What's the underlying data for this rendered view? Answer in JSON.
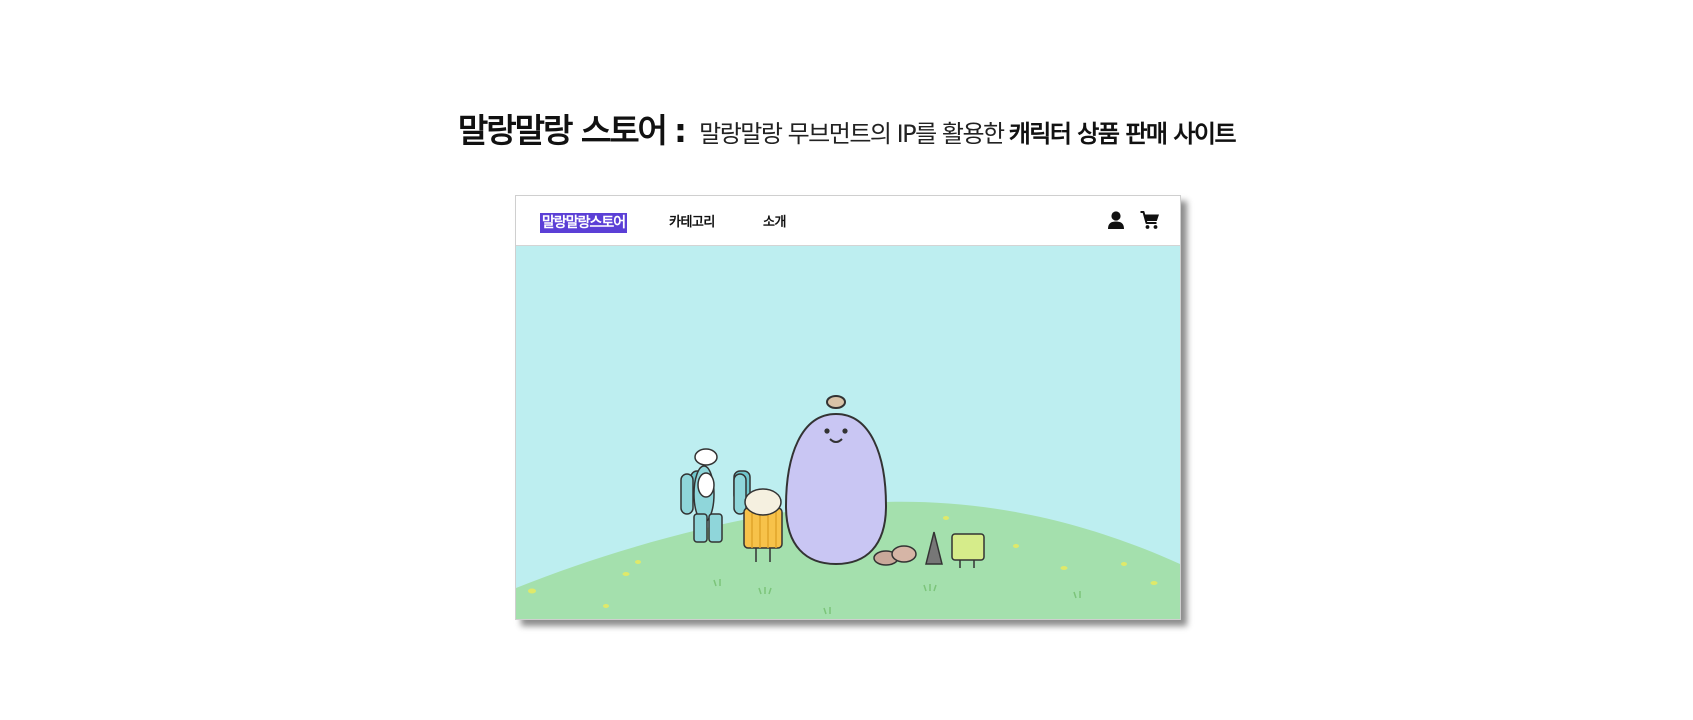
{
  "headline": {
    "brand": "말랑말랑 스토어",
    "colon": ":",
    "desc_light": "말랑말랑 무브먼트의 IP를 활용한",
    "desc_bold": "캐릭터 상품 판매 사이트"
  },
  "navbar": {
    "logo": "말랑말랑스토어",
    "items": [
      "카테고리",
      "소개"
    ],
    "icons": [
      "user-icon",
      "cart-icon"
    ]
  },
  "hero": {
    "background": "#bdeef0",
    "ground": "#a4e0ad",
    "slides": 3,
    "active_slide": 1
  },
  "colors": {
    "accent": "#5b3fd6",
    "dot_inactive": "#b8a4e8"
  }
}
